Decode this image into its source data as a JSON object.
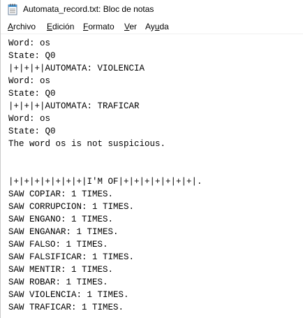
{
  "window": {
    "title": "Automata_record.txt: Bloc de notas"
  },
  "menu": {
    "archivo": {
      "accel": "A",
      "rest": "rchivo"
    },
    "edicion": {
      "accel": "E",
      "rest": "dición"
    },
    "formato": {
      "accel": "F",
      "rest": "ormato"
    },
    "ver": {
      "accel": "V",
      "rest": "er"
    },
    "ayuda": {
      "pre": "Ay",
      "accel": "u",
      "rest": "da"
    }
  },
  "editor": {
    "lines": [
      "Word: os",
      "State: Q0",
      "|+|+|+|AUTOMATA: VIOLENCIA",
      "Word: os",
      "State: Q0",
      "|+|+|+|AUTOMATA: TRAFICAR",
      "Word: os",
      "State: Q0",
      "The word os is not suspicious.",
      "",
      "",
      "|+|+|+|+|+|+|+|I'M OF|+|+|+|+|+|+|+|.",
      "SAW COPIAR: 1 TIMES.",
      "SAW CORRUPCION: 1 TIMES.",
      "SAW ENGANO: 1 TIMES.",
      "SAW ENGANAR: 1 TIMES.",
      "SAW FALSO: 1 TIMES.",
      "SAW FALSIFICAR: 1 TIMES.",
      "SAW MENTIR: 1 TIMES.",
      "SAW ROBAR: 1 TIMES.",
      "SAW VIOLENCIA: 1 TIMES.",
      "SAW TRAFICAR: 1 TIMES."
    ]
  },
  "icons": {
    "app": "notepad-icon"
  }
}
